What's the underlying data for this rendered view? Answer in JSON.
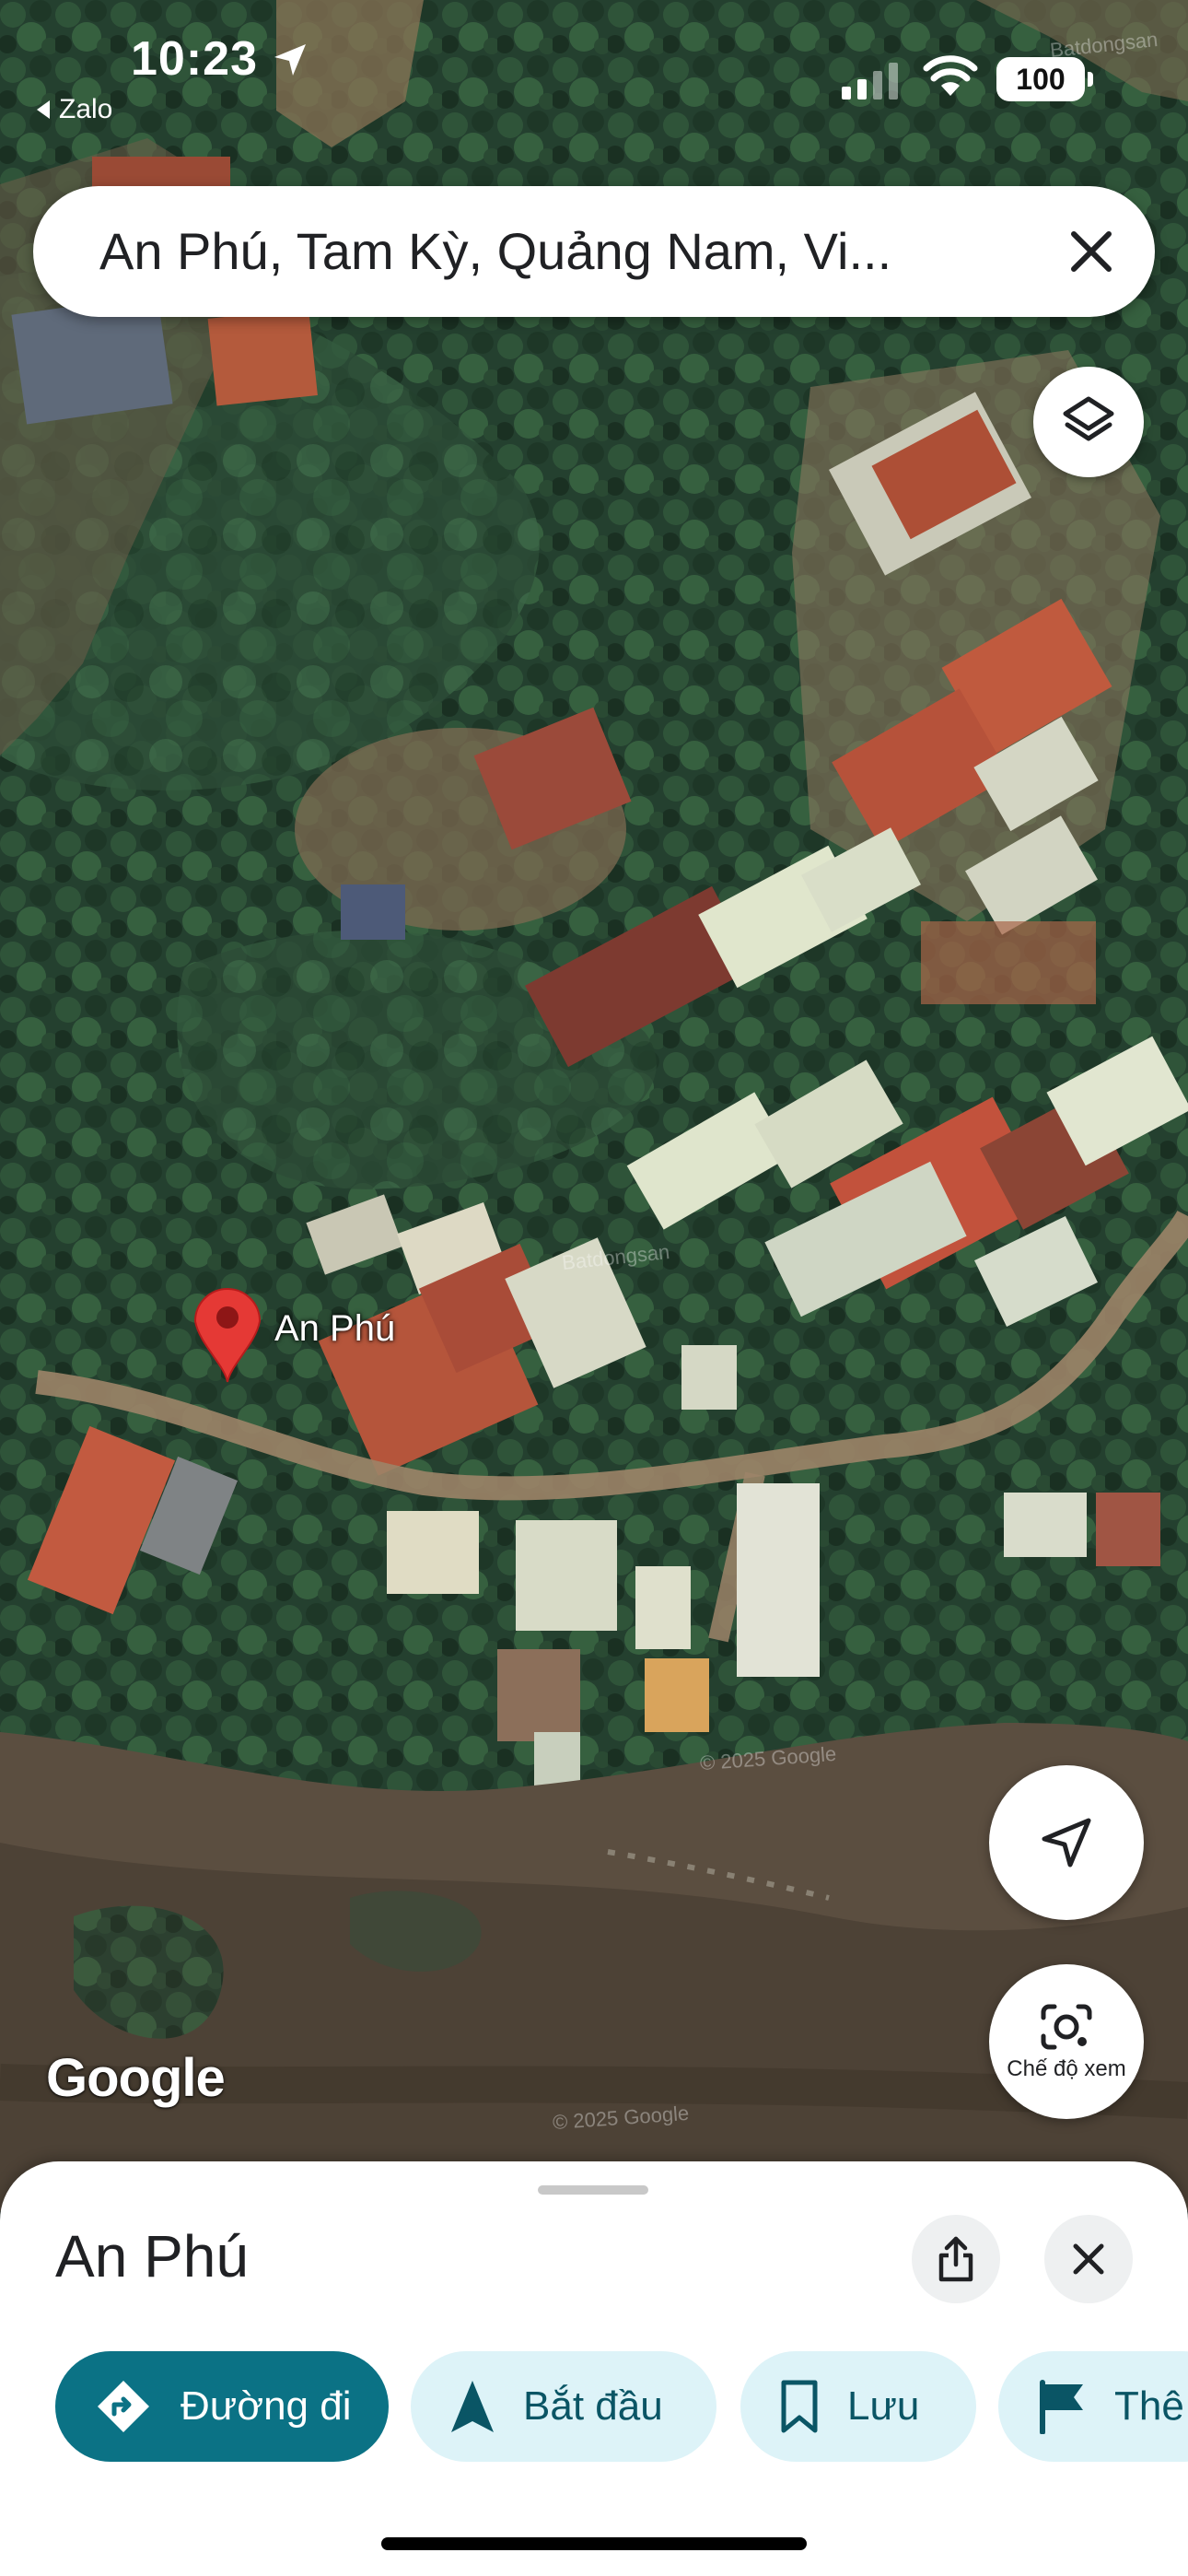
{
  "status_bar": {
    "time": "10:23",
    "back_app": "Zalo",
    "battery": "100",
    "icons": [
      "location-arrow-icon",
      "signal-icon",
      "wifi-icon",
      "battery-icon"
    ]
  },
  "search": {
    "query": "An Phú, Tam Kỳ, Quảng Nam, Vi..."
  },
  "map": {
    "pin_label": "An Phú",
    "attribution": "Google",
    "copyright": "© 2025 Google",
    "watermark": "Batdongsan",
    "view": "satellite"
  },
  "map_buttons": {
    "lens_label": "Chế độ xem",
    "icons": [
      "layers-icon",
      "navigation-arrow-icon",
      "lens-camera-icon"
    ]
  },
  "sheet": {
    "title": "An Phú",
    "actions": [
      {
        "label": "Đường đi",
        "icon": "directions-icon"
      },
      {
        "label": "Bắt đầu",
        "icon": "start-arrow-icon"
      },
      {
        "label": "Lưu",
        "icon": "bookmark-icon"
      },
      {
        "label": "Thê",
        "icon": "flag-icon"
      }
    ]
  },
  "colors": {
    "accent": "#0b7285",
    "chip_bg": "#ddf3f8",
    "pin": "#e53935"
  }
}
